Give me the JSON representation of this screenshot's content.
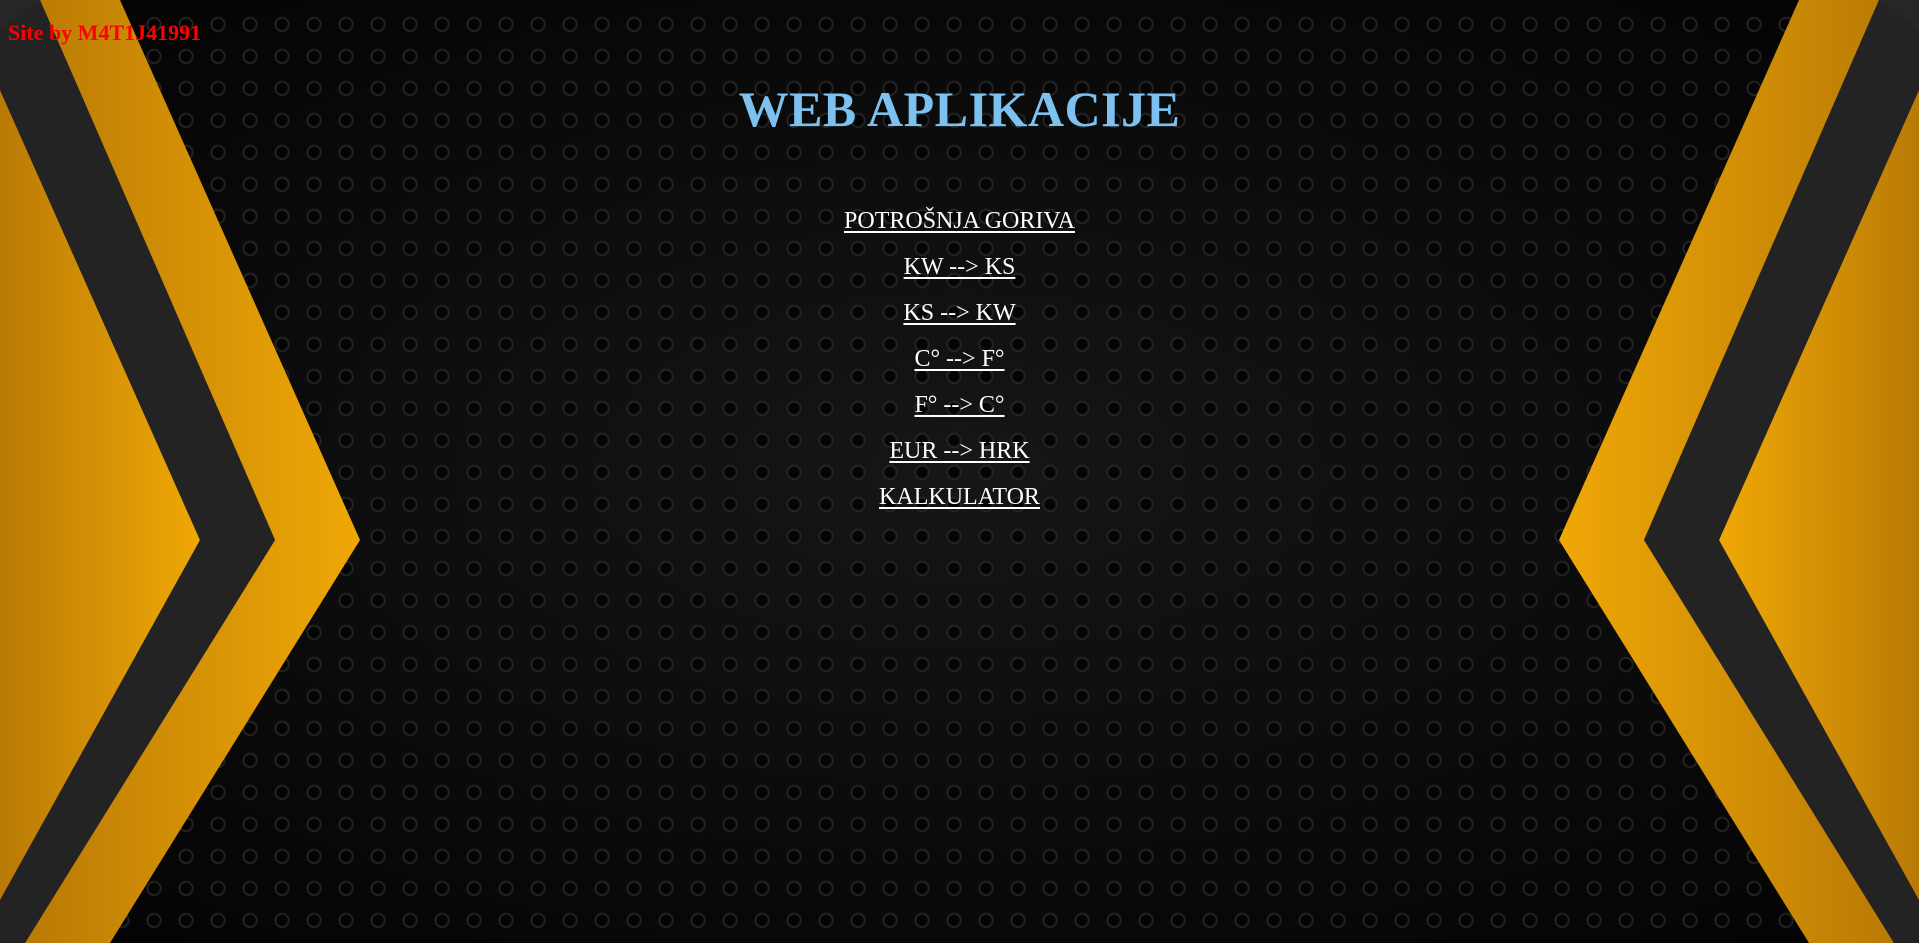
{
  "credit": "Site by M4T1J41991",
  "title": "WEB APLIKACIJE",
  "nav": [
    {
      "label": "POTROŠNJA GORIVA"
    },
    {
      "label": "KW --> KS"
    },
    {
      "label": "KS --> KW"
    },
    {
      "label": "C° --> F°"
    },
    {
      "label": "F° --> C°"
    },
    {
      "label": "EUR --> HRK"
    },
    {
      "label": "KALKULATOR"
    }
  ],
  "colors": {
    "credit": "#ff0000",
    "title": "#7dc1f1",
    "links": "#ffffff",
    "accent_orange": "#e39c05",
    "dark_stripe": "#2a2a2a"
  }
}
